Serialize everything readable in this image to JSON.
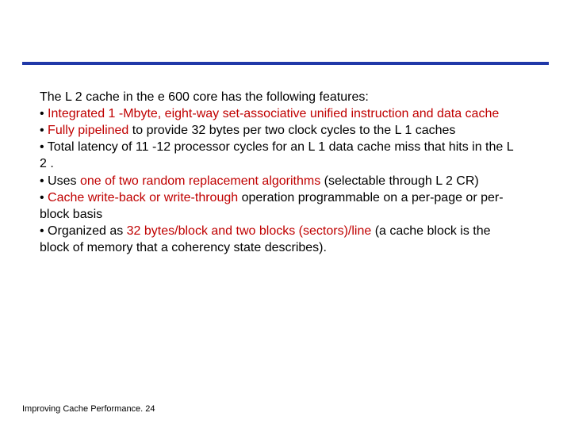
{
  "intro": "The L 2 cache in the e 600 core has the following features:",
  "b1_a": "• ",
  "b1_b": "Integrated 1 -Mbyte, eight-way set-associative unified instruction and data cache",
  "b2_a": "• ",
  "b2_b": "Fully pipelined",
  "b2_c": " to provide 32 bytes per two clock cycles to the L 1 caches",
  "b3": "• Total latency of 11 -12 processor cycles for an L 1 data cache miss that hits in the L 2 .",
  "b4_a": "• Uses ",
  "b4_b": "one of two random replacement algorithms",
  "b4_c": " (selectable through L 2 CR)",
  "b5_a": "• ",
  "b5_b": "Cache write-back or write-through",
  "b5_c": " operation programmable on a per-page or per-block basis",
  "b6_a": "• Organized as ",
  "b6_b": "32 bytes/block and two blocks (sectors)/line",
  "b6_c": " (a cache block is the block of memory that a coherency state describes).",
  "footer_label": "Improving Cache Performance.",
  "footer_page": " 24"
}
